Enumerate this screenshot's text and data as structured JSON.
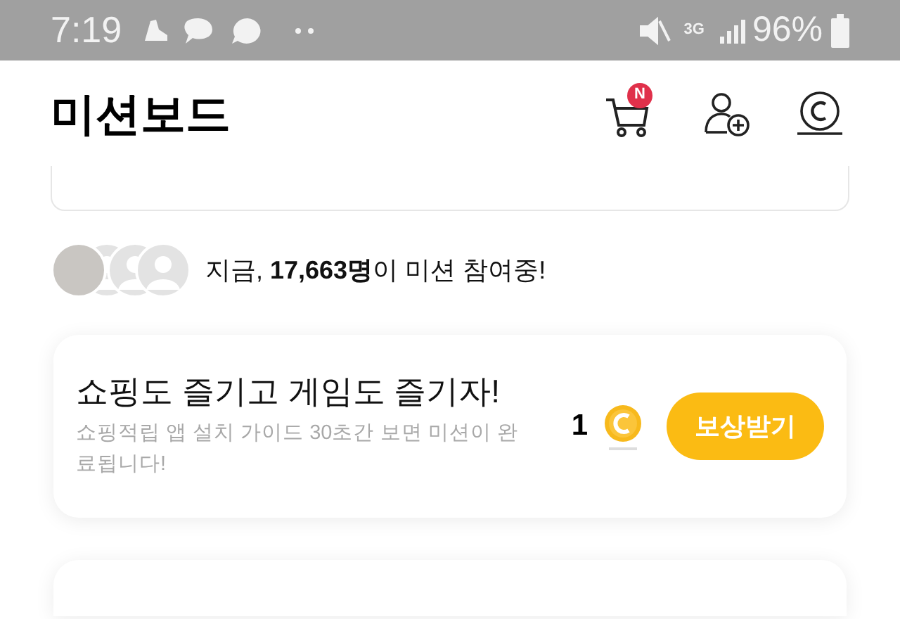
{
  "status_bar": {
    "time": "7:19",
    "network": "3G",
    "battery": "96%"
  },
  "header": {
    "title": "미션보드",
    "cart_badge": "N"
  },
  "participants": {
    "text": "지금, **17,663명**이 미션 참여중!"
  },
  "missions": [
    {
      "title": "쇼핑도 즐기고 게임도 즐기자!",
      "description": "쇼핑적립 앱 설치 가이드 30초간 보면 미션이 완료됩니다!",
      "reward": "1",
      "button": "보상받기"
    }
  ]
}
